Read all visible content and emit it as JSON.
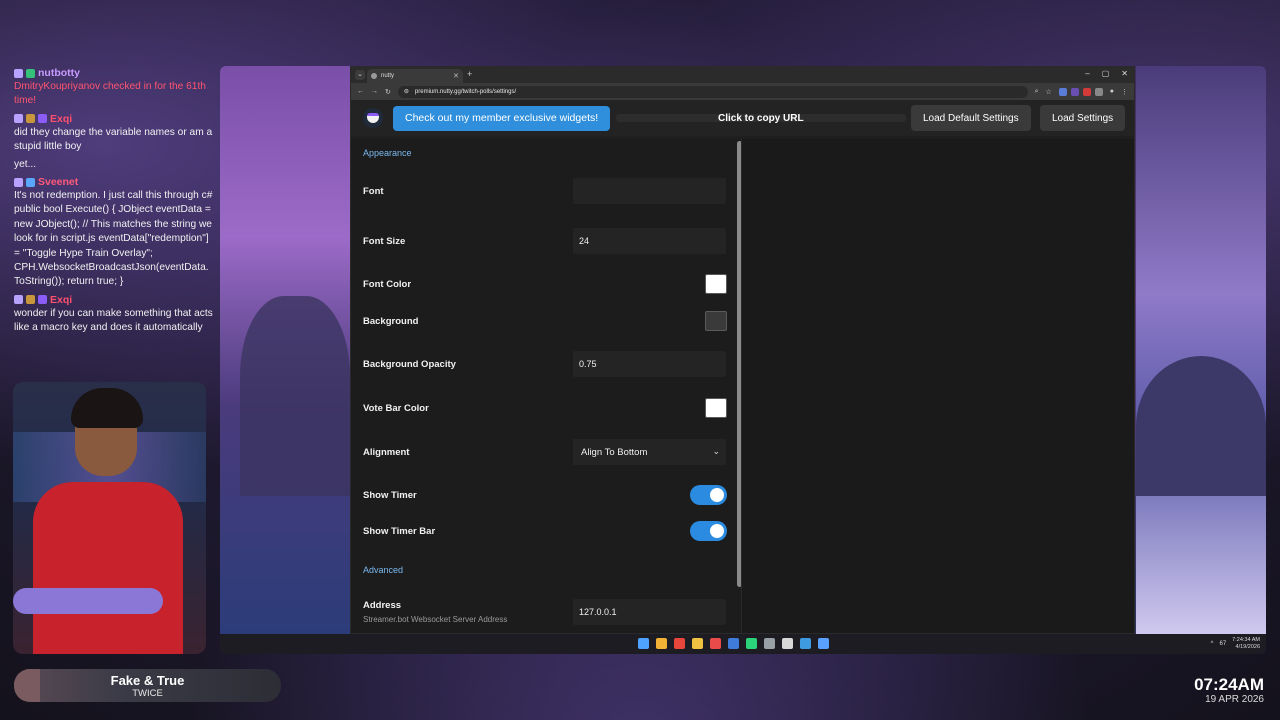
{
  "chat": {
    "messages": [
      {
        "user": "nutbotty",
        "user_color": "#c89bff",
        "badges": [
          "chat",
          "mod"
        ],
        "text": "DmitryKoupriyanov checked in for the 61th time!",
        "text_color": "#ff5470"
      },
      {
        "user": "Exqi",
        "user_color": "#ff4f6d",
        "badges": [
          "chat",
          "sub",
          "vip"
        ],
        "text": "did they change the variable names or am a stupid little boy"
      },
      {
        "user": "",
        "badges": [],
        "text": "yet..."
      },
      {
        "user": "Sveenet",
        "user_color": "#ff5a7a",
        "badges": [
          "chat",
          "prime"
        ],
        "text": "It's not redemption. I just call this through c# public bool Execute() { JObject eventData = new JObject(); // This matches the string we look for in script.js eventData[\"redemption\"] = \"Toggle Hype Train Overlay\"; CPH.WebsocketBroadcastJson(eventData.ToString()); return true; }"
      },
      {
        "user": "Exqi",
        "user_color": "#ff4f6d",
        "badges": [
          "chat",
          "sub",
          "vip"
        ],
        "text": "wonder if you can make something that acts like a macro key and does it automatically"
      }
    ]
  },
  "now_playing": {
    "title": "Fake & True",
    "artist": "TWICE"
  },
  "clock": {
    "time": "07:24AM",
    "date": "19 APR 2026"
  },
  "browser": {
    "tab_title": "nutty",
    "new_tab": "+",
    "url": "premium.nutty.gg/twitch-polls/settings/",
    "window_controls": {
      "minimize": "–",
      "maximize": "▢",
      "close": "✕"
    }
  },
  "page_header": {
    "promo_button": "Check out my member exclusive widgets!",
    "copy_url": "Click to copy URL",
    "load_default_button": "Load Default Settings",
    "load_settings_button": "Load Settings"
  },
  "settings": {
    "appearance_title": "Appearance",
    "advanced_title": "Advanced",
    "font": {
      "label": "Font",
      "value": ""
    },
    "font_size": {
      "label": "Font Size",
      "value": "24"
    },
    "font_color": {
      "label": "Font Color",
      "color": "#ffffff"
    },
    "background": {
      "label": "Background",
      "color": "#3a3a3a"
    },
    "background_opacity": {
      "label": "Background Opacity",
      "value": "0.75"
    },
    "vote_bar_color": {
      "label": "Vote Bar Color",
      "color": "#ffffff"
    },
    "alignment": {
      "label": "Alignment",
      "value": "Align To Bottom"
    },
    "show_timer": {
      "label": "Show Timer",
      "enabled": true
    },
    "show_timer_bar": {
      "label": "Show Timer Bar",
      "enabled": true
    },
    "address": {
      "label": "Address",
      "sublabel": "Streamer.bot Websocket Server Address",
      "value": "127.0.0.1"
    }
  },
  "taskbar": {
    "tray_count": "67",
    "tray_time": "7:24:34 AM",
    "tray_date": "4/19/2026",
    "tray_arrow": "^",
    "icon_colors": [
      "#4da3ff",
      "#f2b233",
      "#e8463b",
      "#f0c040",
      "#e94b4b",
      "#3f7bd8",
      "#2bd37a",
      "#9aa0a8",
      "#d8d8d8",
      "#3f9be0",
      "#5aa0ff"
    ]
  }
}
